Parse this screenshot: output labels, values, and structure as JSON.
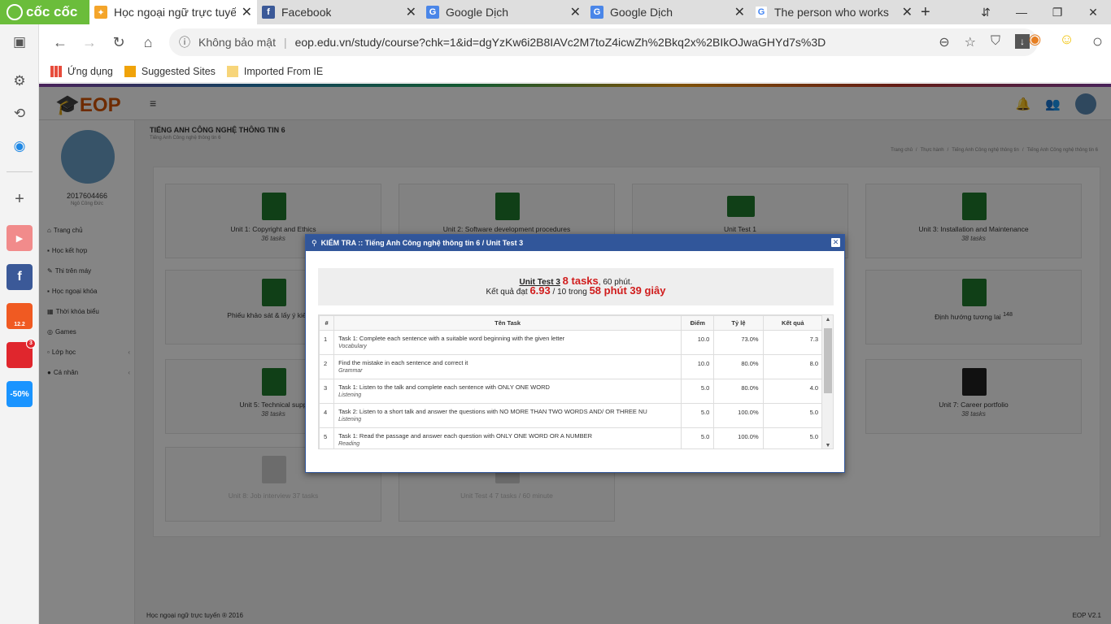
{
  "browser": {
    "brand": "cốc cốc",
    "tabs": [
      {
        "title": "Học ngoại ngữ trực tuyế",
        "icon": "eop-icon",
        "active": true
      },
      {
        "title": "Facebook",
        "icon": "facebook-icon",
        "active": false
      },
      {
        "title": "Google Dịch",
        "icon": "google-translate-icon",
        "active": false
      },
      {
        "title": "Google Dịch",
        "icon": "google-translate-icon",
        "active": false
      },
      {
        "title": "The person who works",
        "icon": "google-icon",
        "active": false
      }
    ],
    "new_tab": "+",
    "address": {
      "security": "Không bảo mật",
      "url": "eop.edu.vn/study/course?chk=1&id=dgYzKw6i2B8IAVc2M7toZ4icwZh%2Bkq2x%2BIkOJwaGHYd7s%3D"
    },
    "bookmarks": [
      "Ứng dụng",
      "Suggested Sites",
      "Imported From IE"
    ],
    "sidebar_badges": {
      "shopee": "12.2",
      "sendo": "3",
      "tiki": "-50%"
    }
  },
  "site": {
    "logo": "EOP",
    "course_title": "TIẾNG ANH CÔNG NGHỆ THÔNG TIN 6",
    "course_subtitle": "Tiếng Anh Công nghệ thông tin 6",
    "breadcrumb": [
      "Trang chủ",
      "Thực hành",
      "Tiếng Anh Công nghệ thông tin",
      "Tiếng Anh Công nghệ thông tin 6"
    ],
    "user": {
      "id": "2017604466",
      "name": "Ngô Công Đức"
    },
    "menu": [
      {
        "label": "Trang chủ",
        "icon": "home-icon"
      },
      {
        "label": "Học kết hợp",
        "icon": "book-icon"
      },
      {
        "label": "Thi trên máy",
        "icon": "pencil-icon"
      },
      {
        "label": "Học ngoại khóa",
        "icon": "book-icon"
      },
      {
        "label": "Thời khóa biểu",
        "icon": "calendar-icon"
      },
      {
        "label": "Games",
        "icon": "gamepad-icon"
      },
      {
        "label": "Lớp học",
        "icon": "folder-icon"
      },
      {
        "label": "Cá nhân",
        "icon": "user-icon"
      }
    ],
    "units": [
      {
        "title": "Unit 1: Copyright and Ethics",
        "sub": "36 tasks"
      },
      {
        "title": "Unit 2: Software development procedures",
        "sub": ""
      },
      {
        "title": "Unit Test 1",
        "sub": ""
      },
      {
        "title": "Unit 3: Installation and Maintenance",
        "sub": "38 tasks"
      },
      {
        "title": "Phiếu khảo sát & lấy ý kiến về",
        "sub": ""
      },
      {
        "title": "Định hướng tương lai",
        "sub": "148"
      },
      {
        "title": "Unit 5: Technical supp",
        "sub": "38 tasks"
      },
      {
        "title": "Unit 7: Career portfolio",
        "sub": "38 tasks"
      },
      {
        "title": "Unit 8: Job interview  37 tasks",
        "sub": ""
      },
      {
        "title": "Unit Test 4  7 tasks / 60 minute",
        "sub": ""
      }
    ],
    "footer_left": "Học ngoại ngữ trực tuyến ® 2016",
    "footer_right": "EOP V2.1"
  },
  "modal": {
    "title": "KIỂM TRA :: Tiếng Anh Công nghệ thông tin 6 / Unit Test 3",
    "test_name": "Unit Test 3",
    "tasks": "8 tasks",
    "duration": "60 phút.",
    "result_prefix": "Kết quả đạt",
    "score": "6.93",
    "score_max": "/ 10 trong",
    "time_spent": "58 phút 39 giây",
    "columns": [
      "#",
      "Tên Task",
      "Điểm",
      "Tỷ lệ",
      "Kết quả"
    ],
    "rows": [
      {
        "no": "1",
        "task": "Task 1: Complete each sentence with a suitable word beginning with the given letter",
        "skill": "Vocabulary",
        "points": "10.0",
        "ratio": "73.0%",
        "result": "7.3"
      },
      {
        "no": "2",
        "task": "Find the mistake in each sentence and correct it",
        "skill": "Grammar",
        "points": "10.0",
        "ratio": "80.0%",
        "result": "8.0"
      },
      {
        "no": "3",
        "task": "Task 1: Listen to the talk and complete each sentence with ONLY ONE WORD",
        "skill": "Listening",
        "points": "5.0",
        "ratio": "80.0%",
        "result": "4.0"
      },
      {
        "no": "4",
        "task": "Task 2: Listen to a short talk and answer the questions with NO MORE THAN TWO WORDS AND/ OR THREE NU",
        "skill": "Listening",
        "points": "5.0",
        "ratio": "100.0%",
        "result": "5.0"
      },
      {
        "no": "5",
        "task": "Task 1: Read the passage and answer each question with ONLY ONE WORD OR A NUMBER",
        "skill": "Reading",
        "points": "5.0",
        "ratio": "100.0%",
        "result": "5.0"
      }
    ]
  }
}
